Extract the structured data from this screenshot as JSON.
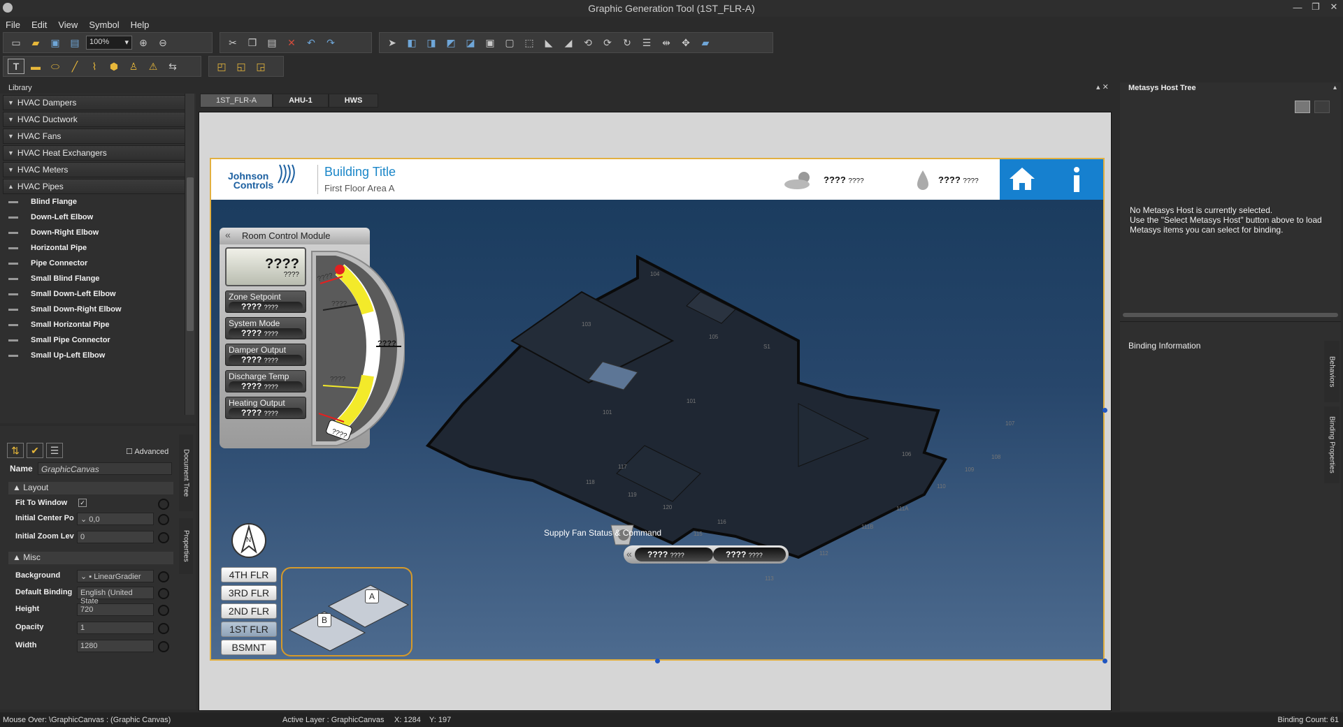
{
  "window": {
    "title": "Graphic Generation Tool (1ST_FLR-A)",
    "minimize": "—",
    "restore": "❐",
    "close": "✕"
  },
  "menu": [
    "File",
    "Edit",
    "View",
    "Symbol",
    "Help"
  ],
  "toolbar": {
    "zoom": "100%"
  },
  "library": {
    "header": "Library",
    "categories": [
      {
        "label": "HVAC Dampers"
      },
      {
        "label": "HVAC Ductwork"
      },
      {
        "label": "HVAC Fans"
      },
      {
        "label": "HVAC Heat Exchangers"
      },
      {
        "label": "HVAC Meters"
      },
      {
        "label": "HVAC Pipes"
      }
    ],
    "items": [
      "Blind Flange",
      "Down-Left Elbow",
      "Down-Right Elbow",
      "Horizontal Pipe",
      "Pipe Connector",
      "Small Blind Flange",
      "Small Down-Left Elbow",
      "Small Down-Right Elbow",
      "Small Horizontal Pipe",
      "Small Pipe Connector",
      "Small Up-Left Elbow"
    ]
  },
  "properties": {
    "advanced": "Advanced",
    "name_label": "Name",
    "name_value": "GraphicCanvas",
    "layout_header": "Layout",
    "misc_header": "Misc",
    "layout": [
      {
        "label": "Fit To Window",
        "value": ""
      },
      {
        "label": "Initial Center Po",
        "value": "0,0"
      },
      {
        "label": "Initial Zoom Lev",
        "value": "0"
      }
    ],
    "misc": [
      {
        "label": "Background",
        "value": "LinearGradier"
      },
      {
        "label": "Default Binding",
        "value": "English (United State"
      },
      {
        "label": "Height",
        "value": "720"
      },
      {
        "label": "Opacity",
        "value": "1"
      },
      {
        "label": "Width",
        "value": "1280"
      }
    ],
    "side_tabs": [
      "Document Tree",
      "Properties"
    ]
  },
  "tabs": [
    {
      "label": "1ST_FLR-A",
      "active": true
    },
    {
      "label": "AHU-1",
      "active": false
    },
    {
      "label": "HWS",
      "active": false
    }
  ],
  "canvas": {
    "logo_top": "Johnson",
    "logo_bottom": "Controls",
    "building_title": "Building Title",
    "building_subtitle": "First Floor Area A",
    "weather_value": "????",
    "weather_unit": "????",
    "humidity_value": "????",
    "humidity_unit": "????",
    "rcm": {
      "title": "Room Control Module",
      "lcd_value": "????",
      "lcd_unit": "????",
      "rows": [
        {
          "label": "Zone Setpoint",
          "value": "????",
          "unit": "????"
        },
        {
          "label": "System Mode",
          "value": "????",
          "unit": "????"
        },
        {
          "label": "Damper Output",
          "value": "????",
          "unit": "????"
        },
        {
          "label": "Discharge Temp",
          "value": "????",
          "unit": "????"
        },
        {
          "label": "Heating Output",
          "value": "????",
          "unit": "????"
        }
      ],
      "gauge_labels": [
        "????",
        "????",
        "????",
        "????",
        "????"
      ]
    },
    "floors": [
      "4TH FLR",
      "3RD FLR",
      "2ND FLR",
      "1ST FLR",
      "BSMNT"
    ],
    "active_floor": "1ST FLR",
    "minimap": {
      "a": "A",
      "b": "B"
    },
    "compass": "N",
    "rooms": [
      "104",
      "103",
      "105",
      "S1",
      "101",
      "101",
      "107",
      "108",
      "109",
      "110",
      "106",
      "111A",
      "111B",
      "112",
      "113",
      "114",
      "115",
      "116",
      "117",
      "118",
      "119",
      "120"
    ],
    "supply_fan": {
      "label": "Supply Fan Status & Command",
      "status": "????",
      "status_unit": "????",
      "command": "????",
      "command_unit": "????"
    }
  },
  "right_panel": {
    "host_tree_title": "Metasys Host Tree",
    "host_msg_1": "No Metasys Host is currently selected.",
    "host_msg_2": "Use the \"Select Metasys Host\" button above to load",
    "host_msg_3": "Metasys items you can select for binding.",
    "binding_title": "Binding Information",
    "side_tabs": [
      "Behaviors",
      "Binding Properties"
    ]
  },
  "status": {
    "mouse_over": "Mouse Over: \\GraphicCanvas : (Graphic Canvas)",
    "active_layer": "Active Layer : GraphicCanvas",
    "x": "X: 1284",
    "y": "Y: 197",
    "binding_count": "Binding Count: 61"
  }
}
